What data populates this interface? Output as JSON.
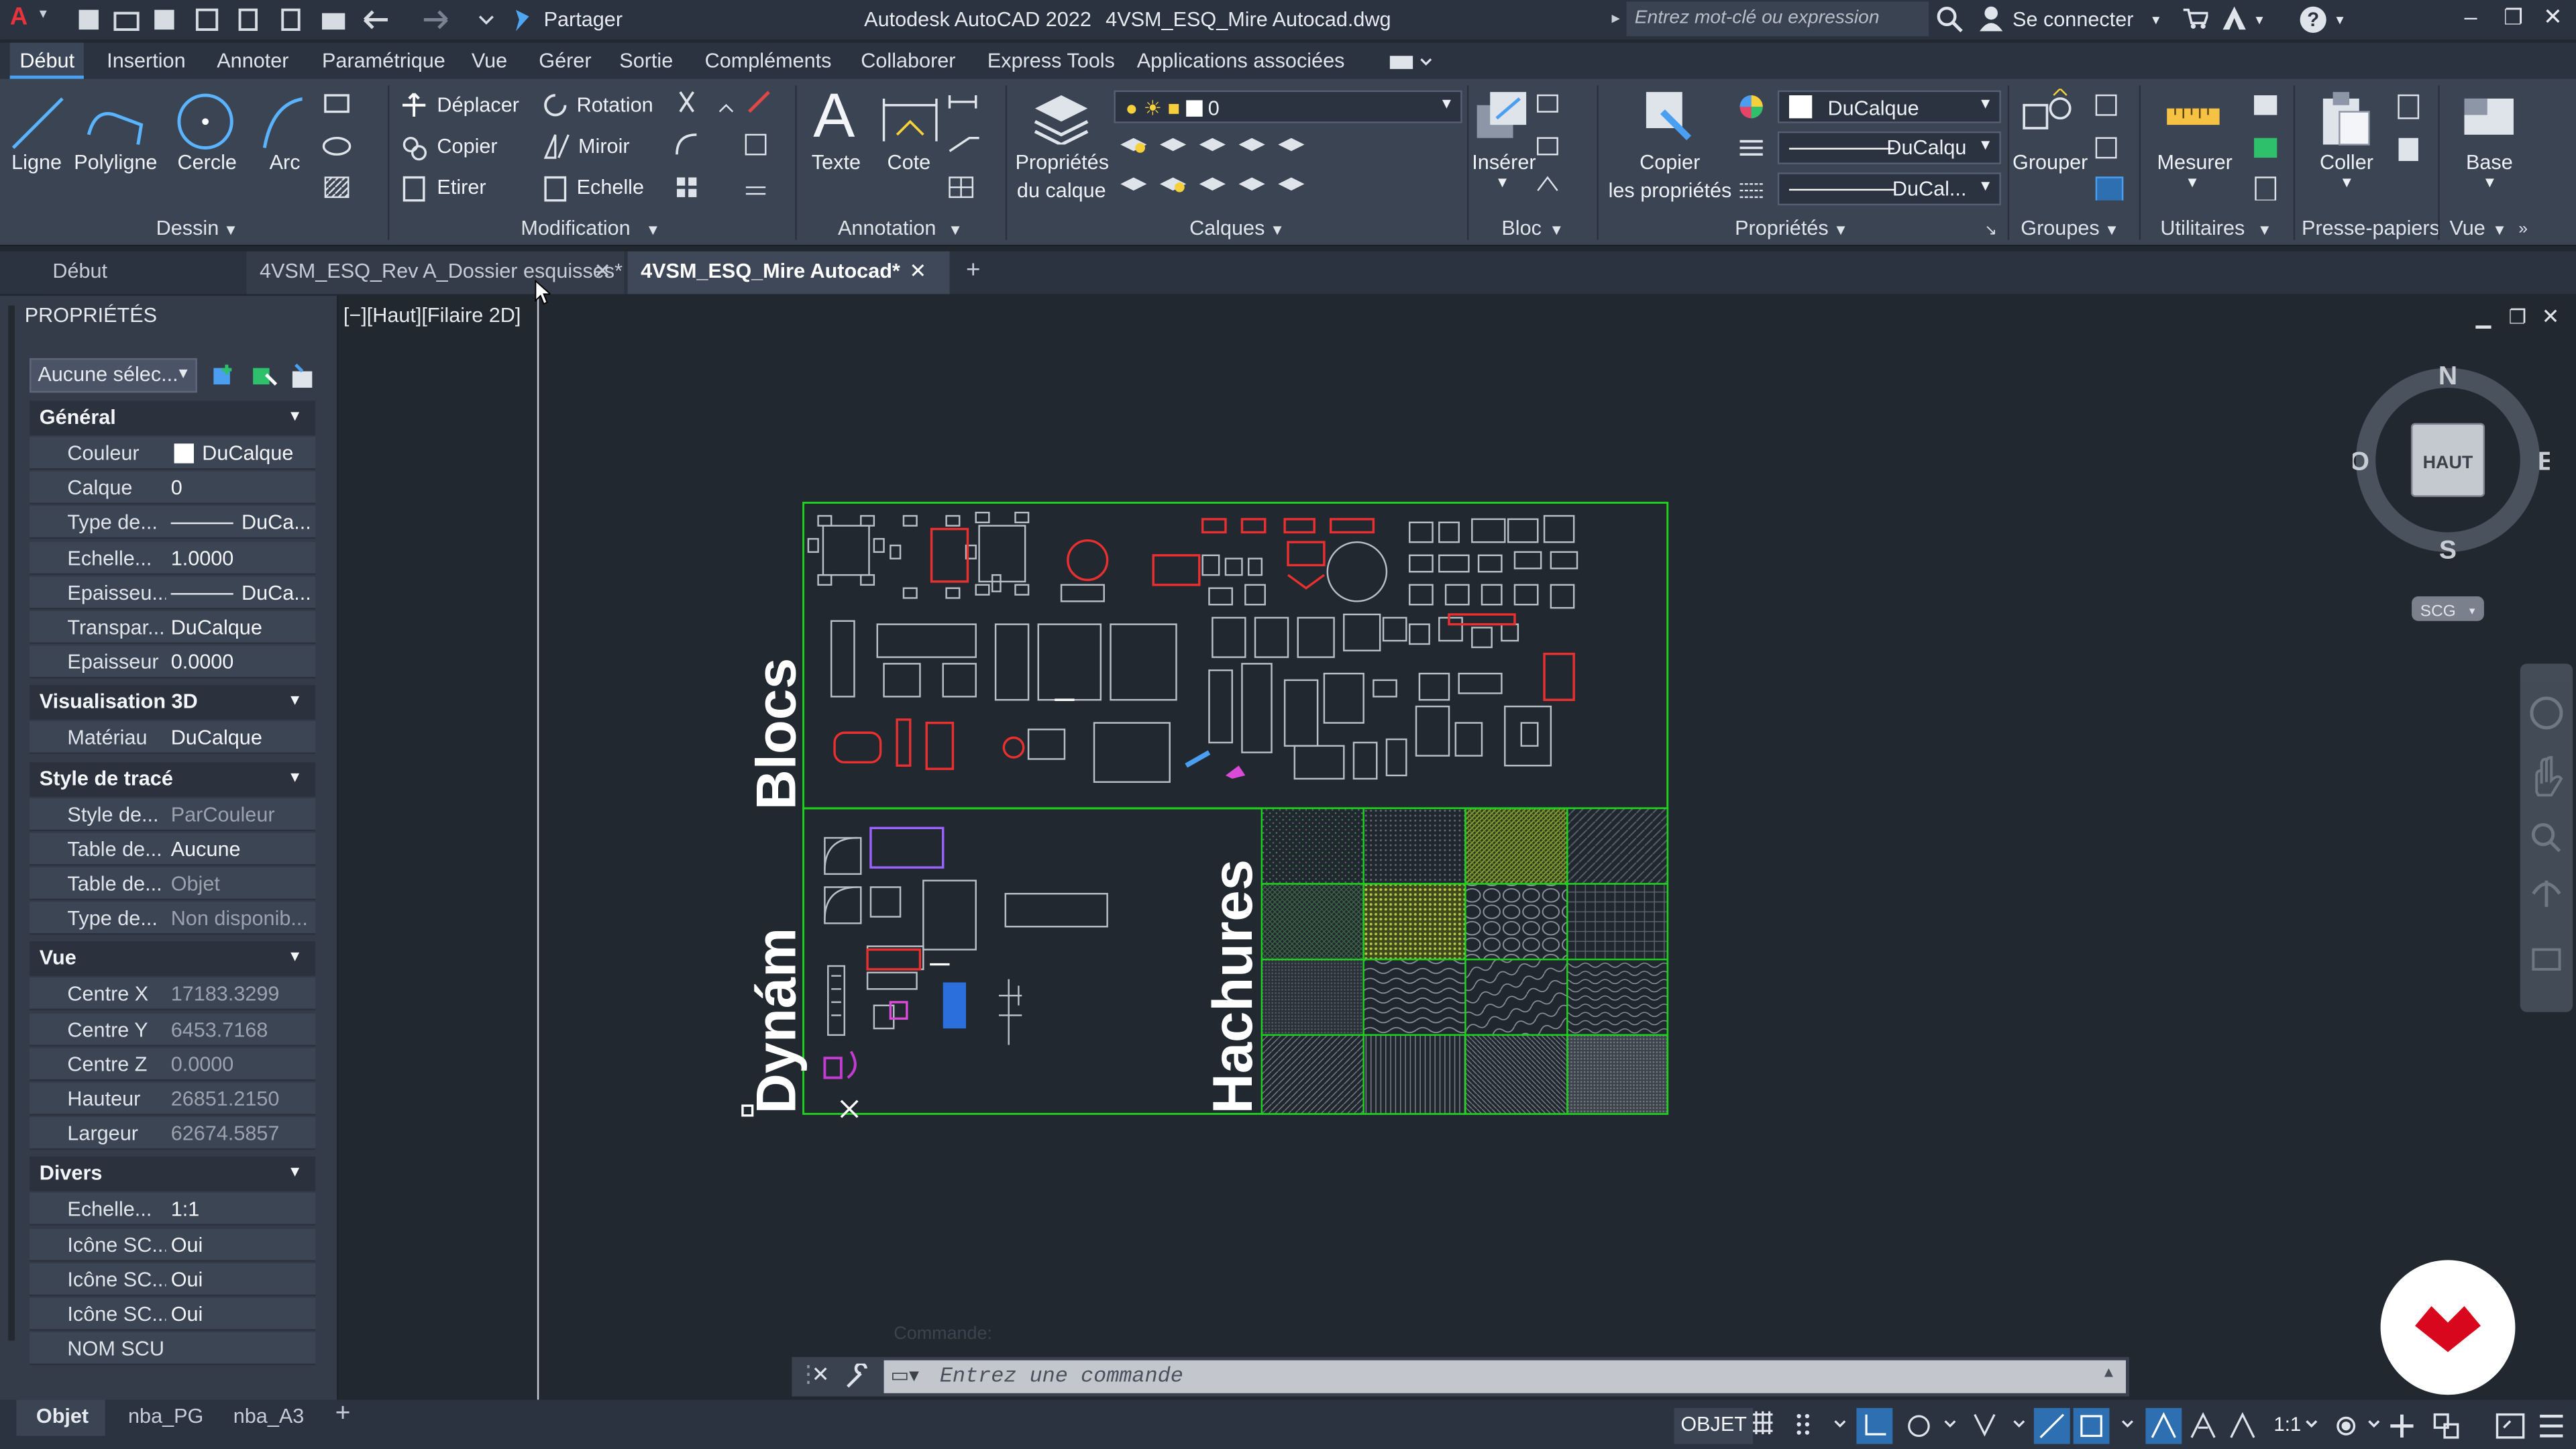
{
  "titlebar": {
    "share": "Partager",
    "app": "Autodesk AutoCAD 2022",
    "file": "4VSM_ESQ_Mire Autocad.dwg",
    "search_placeholder": "Entrez mot-clé ou expression",
    "signin": "Se connecter"
  },
  "menu": [
    "Début",
    "Insertion",
    "Annoter",
    "Paramétrique",
    "Vue",
    "Gérer",
    "Sortie",
    "Compléments",
    "Collaborer",
    "Express Tools",
    "Applications associées"
  ],
  "ribbon": {
    "dessin": {
      "title": "Dessin",
      "tools": [
        "Ligne",
        "Polyligne",
        "Cercle",
        "Arc"
      ]
    },
    "modification": {
      "title": "Modification",
      "items": [
        "Déplacer",
        "Rotation",
        "Copier",
        "Miroir",
        "Etirer",
        "Echelle"
      ]
    },
    "annotation": {
      "title": "Annotation",
      "tools": [
        "Texte",
        "Cote"
      ]
    },
    "calques": {
      "title": "Calques",
      "prop1": "Propriétés",
      "prop2": "du calque",
      "layer": "0"
    },
    "bloc": {
      "title": "Bloc",
      "insert": "Insérer"
    },
    "proprietes": {
      "title": "Propriétés",
      "copy1": "Copier",
      "copy2": "les propriétés",
      "color": "DuCalque",
      "linetype": "DuCalqu",
      "lineweight": "DuCal..."
    },
    "groupes": {
      "title": "Groupes",
      "group": "Grouper"
    },
    "utilitaires": {
      "title": "Utilitaires",
      "measure": "Mesurer"
    },
    "pressepapiers": {
      "title": "Presse-papiers",
      "paste": "Coller"
    },
    "vue": {
      "title": "Vue",
      "base": "Base"
    }
  },
  "tabs": [
    "Début",
    "4VSM_ESQ_Rev A_Dossier esquisses*",
    "4VSM_ESQ_Mire Autocad*"
  ],
  "props": {
    "title": "PROPRIÉTÉS",
    "selection": "Aucune sélec...",
    "sections": [
      {
        "name": "Général",
        "rows": [
          [
            "Couleur",
            "DuCalque"
          ],
          [
            "Calque",
            "0"
          ],
          [
            "Type de...",
            "DuCa..."
          ],
          [
            "Echelle...",
            "1.0000"
          ],
          [
            "Epaisseu...",
            "DuCa..."
          ],
          [
            "Transpar...",
            "DuCalque"
          ],
          [
            "Epaisseur",
            "0.0000"
          ]
        ]
      },
      {
        "name": "Visualisation 3D",
        "rows": [
          [
            "Matériau",
            "DuCalque"
          ]
        ]
      },
      {
        "name": "Style de tracé",
        "rows": [
          [
            "Style de...",
            "ParCouleur"
          ],
          [
            "Table de...",
            "Aucune"
          ],
          [
            "Table de...",
            "Objet"
          ],
          [
            "Type de...",
            "Non disponib..."
          ]
        ]
      },
      {
        "name": "Vue",
        "rows": [
          [
            "Centre X",
            "17183.3299"
          ],
          [
            "Centre Y",
            "6453.7168"
          ],
          [
            "Centre Z",
            "0.0000"
          ],
          [
            "Hauteur",
            "26851.2150"
          ],
          [
            "Largeur",
            "62674.5857"
          ]
        ]
      },
      {
        "name": "Divers",
        "rows": [
          [
            "Echelle...",
            "1:1"
          ],
          [
            "Icône SC...",
            "Oui"
          ],
          [
            "Icône SC...",
            "Oui"
          ],
          [
            "Icône SC...",
            "Oui"
          ],
          [
            "NOM SCU",
            ""
          ]
        ]
      }
    ]
  },
  "viewport": {
    "label": "[−][Haut][Filaire 2D]",
    "viewcube": {
      "n": "N",
      "s": "S",
      "e": "E",
      "w": "O",
      "face": "HAUT",
      "ucs": "SCG"
    },
    "drawing": {
      "blocs": "Blocs",
      "dynam": "Dynám",
      "hachures": "Hachures"
    }
  },
  "command": {
    "history": "Commande:",
    "placeholder": "Entrez une commande"
  },
  "layouts": [
    "Objet",
    "nba_PG",
    "nba_A3"
  ],
  "status": {
    "mode": "OBJET",
    "scale": "1:1"
  },
  "colors": {
    "accent": "#4a9ff0",
    "frame": "#1fd11f",
    "block_red": "#e83030",
    "logo": "#d9071e"
  }
}
